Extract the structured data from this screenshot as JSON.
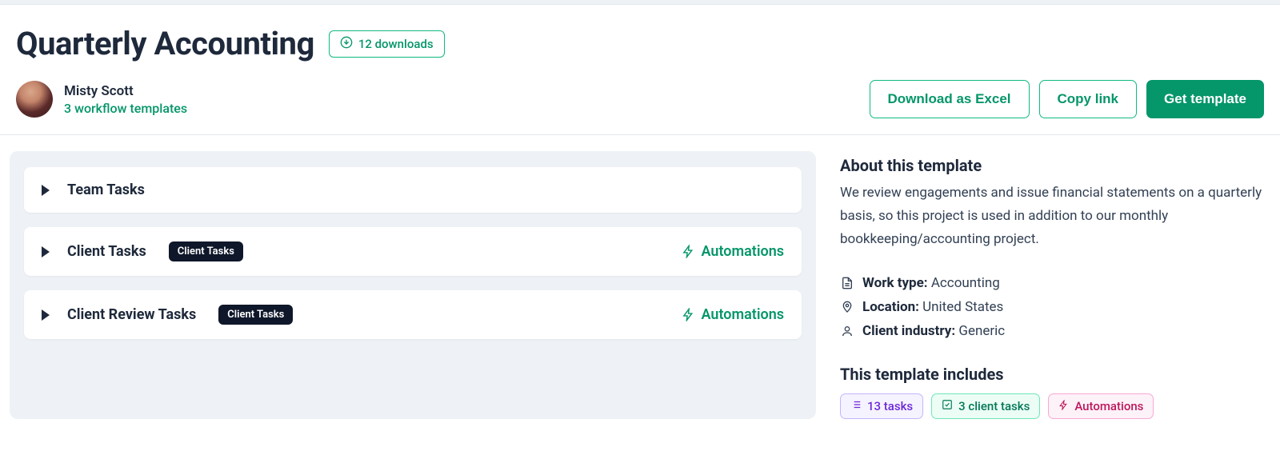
{
  "header": {
    "title": "Quarterly Accounting",
    "downloads_badge": "12 downloads"
  },
  "author": {
    "name": "Misty Scott",
    "subline": "3 workflow templates"
  },
  "actions": {
    "download_excel": "Download as Excel",
    "copy_link": "Copy link",
    "get_template": "Get template"
  },
  "sections": [
    {
      "title": "Team Tasks",
      "pill": null,
      "automations": false
    },
    {
      "title": "Client Tasks",
      "pill": "Client Tasks",
      "automations": true
    },
    {
      "title": "Client Review Tasks",
      "pill": "Client Tasks",
      "automations": true
    }
  ],
  "automations_label": "Automations",
  "about": {
    "heading": "About this template",
    "description": "We review engagements and issue financial statements on a quarterly basis, so this project is used in addition to our monthly bookkeeping/accounting project."
  },
  "meta": {
    "work_type_label": "Work type:",
    "work_type_value": "Accounting",
    "location_label": "Location:",
    "location_value": "United States",
    "industry_label": "Client industry:",
    "industry_value": "Generic"
  },
  "includes": {
    "heading": "This template includes",
    "chips": {
      "tasks": "13 tasks",
      "client_tasks": "3 client tasks",
      "automations": "Automations"
    }
  }
}
